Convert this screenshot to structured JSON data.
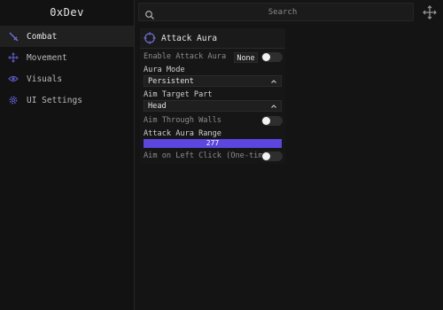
{
  "app": {
    "title": "0xDev"
  },
  "sidebar": {
    "items": [
      {
        "label": "Combat",
        "icon": "sword-icon",
        "active": true
      },
      {
        "label": "Movement",
        "icon": "move-arrows-icon",
        "active": false
      },
      {
        "label": "Visuals",
        "icon": "eye-icon",
        "active": false
      },
      {
        "label": "UI Settings",
        "icon": "gear-icon",
        "active": false
      }
    ]
  },
  "search": {
    "placeholder": "Search",
    "value": ""
  },
  "panel": {
    "title": "Attack Aura",
    "icon": "crosshair-icon",
    "enable": {
      "label": "Enable Attack Aura",
      "badge": "None",
      "on": false
    },
    "aura_mode": {
      "label": "Aura Mode",
      "value": "Persistent"
    },
    "aim_part": {
      "label": "Aim Target Part",
      "value": "Head"
    },
    "walls": {
      "label": "Aim Through Walls",
      "on": false
    },
    "range": {
      "label": "Attack Aura Range",
      "value": "277",
      "fraction": 1.0
    },
    "left_click": {
      "label": "Aim on Left Click (One-time)",
      "on": false
    }
  },
  "colors": {
    "background": "#141414",
    "sidebar": "#121212",
    "accent": "#5b47e0",
    "text": "#d8d8d8"
  }
}
